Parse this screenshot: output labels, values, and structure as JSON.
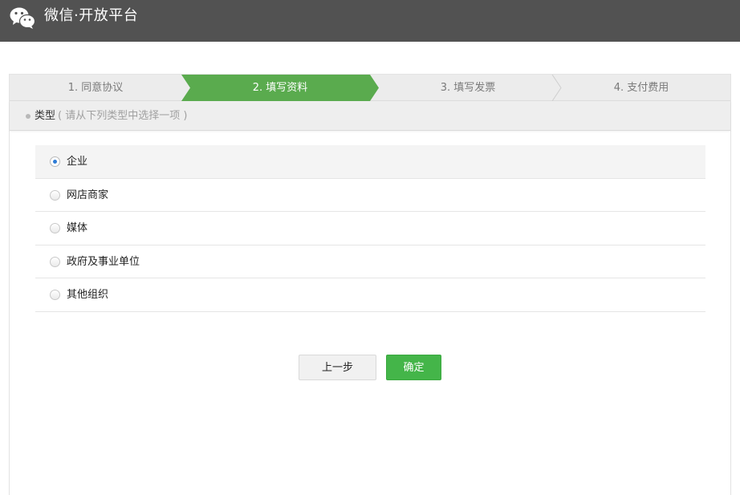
{
  "header": {
    "brand": "微信·开放平台",
    "logo_icon": "wechat-logo-icon"
  },
  "steps": [
    {
      "label": "1. 同意协议",
      "active": false
    },
    {
      "label": "2. 填写资料",
      "active": true
    },
    {
      "label": "3. 填写发票",
      "active": false
    },
    {
      "label": "4. 支付费用",
      "active": false
    }
  ],
  "section": {
    "title": "类型",
    "hint": "( 请从下列类型中选择一项 )"
  },
  "options": [
    {
      "label": "企业",
      "selected": true
    },
    {
      "label": "网店商家",
      "selected": false
    },
    {
      "label": "媒体",
      "selected": false
    },
    {
      "label": "政府及事业单位",
      "selected": false
    },
    {
      "label": "其他组织",
      "selected": false
    }
  ],
  "buttons": {
    "prev": "上一步",
    "confirm": "确定"
  },
  "colors": {
    "topbar": "#525252",
    "active_step": "#5aab4e",
    "confirm_button": "#44b549",
    "radio_dot": "#2e7cd6"
  }
}
